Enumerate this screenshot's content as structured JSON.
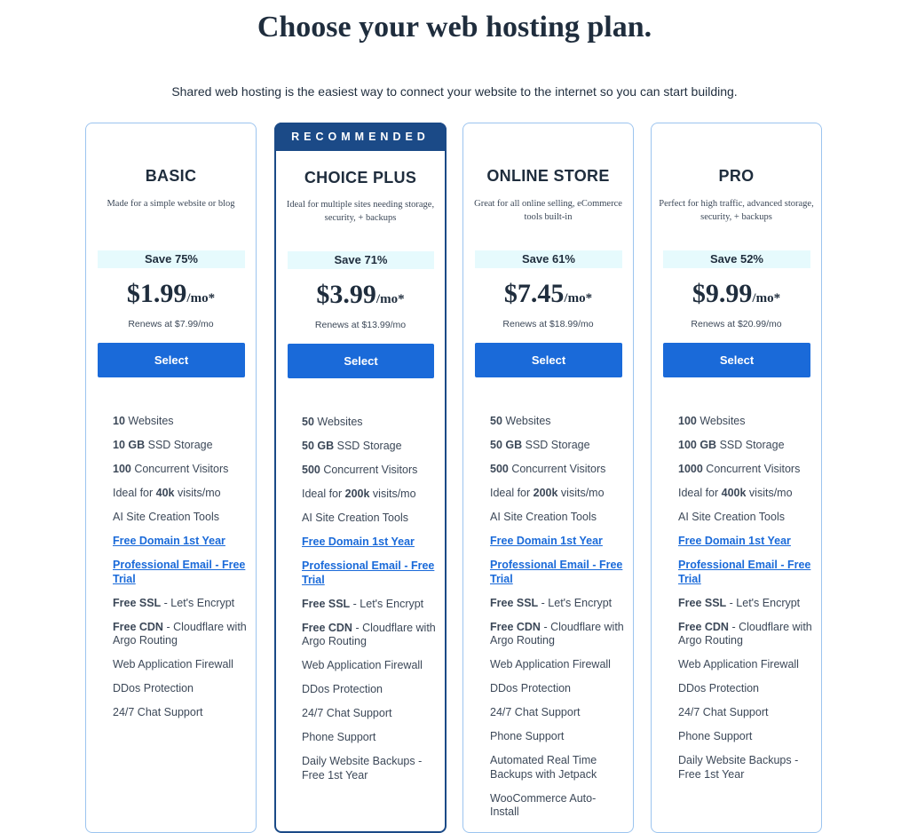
{
  "header": {
    "title": "Choose your web hosting plan.",
    "subtitle": "Shared web hosting is the easiest way to connect your website to the internet so you can start building."
  },
  "recommended_label": "RECOMMENDED",
  "colors": {
    "accent": "#1a6ad9",
    "recommended": "#1b4a87",
    "save_bg": "#e6fafd",
    "card_border": "#9cc4ef"
  },
  "plans": [
    {
      "name": "BASIC",
      "description": "Made for a simple website or blog",
      "save": "Save 75%",
      "price": "$1.99",
      "per": "/mo*",
      "renews": "Renews at $7.99/mo",
      "button": "Select",
      "features": [
        {
          "bold": "10",
          "text": " Websites"
        },
        {
          "bold": "10 GB",
          "text": " SSD Storage"
        },
        {
          "bold": "100",
          "text": " Concurrent Visitors"
        },
        {
          "pre": "Ideal for ",
          "bold": "40k",
          "text": " visits/mo"
        },
        {
          "text": "AI Site Creation Tools"
        },
        {
          "link": "Free Domain 1st Year"
        },
        {
          "link": "Professional Email - Free Trial"
        },
        {
          "bold": "Free SSL",
          "text": " - Let's Encrypt"
        },
        {
          "bold": "Free CDN",
          "text": " - Cloudflare with Argo Routing"
        },
        {
          "text": "Web Application Firewall"
        },
        {
          "text": "DDos Protection"
        },
        {
          "text": "24/7 Chat Support"
        }
      ]
    },
    {
      "name": "CHOICE PLUS",
      "recommended": true,
      "description": "Ideal for multiple sites needing storage, security, + backups",
      "save": "Save 71%",
      "price": "$3.99",
      "per": "/mo*",
      "renews": "Renews at $13.99/mo",
      "button": "Select",
      "features": [
        {
          "bold": "50",
          "text": " Websites"
        },
        {
          "bold": "50 GB",
          "text": " SSD Storage"
        },
        {
          "bold": "500",
          "text": " Concurrent Visitors"
        },
        {
          "pre": "Ideal for ",
          "bold": "200k",
          "text": " visits/mo"
        },
        {
          "text": "AI Site Creation Tools"
        },
        {
          "link": "Free Domain 1st Year"
        },
        {
          "link": "Professional Email - Free Trial"
        },
        {
          "bold": "Free SSL",
          "text": " - Let's Encrypt"
        },
        {
          "bold": "Free CDN",
          "text": " - Cloudflare with Argo Routing"
        },
        {
          "text": "Web Application Firewall"
        },
        {
          "text": "DDos Protection"
        },
        {
          "text": "24/7 Chat Support"
        },
        {
          "text": "Phone Support"
        },
        {
          "text": "Daily Website Backups - Free 1st Year"
        }
      ]
    },
    {
      "name": "ONLINE STORE",
      "description": "Great for all online selling, eCommerce tools built-in",
      "save": "Save 61%",
      "price": "$7.45",
      "per": "/mo*",
      "renews": "Renews at $18.99/mo",
      "button": "Select",
      "features": [
        {
          "bold": "50",
          "text": " Websites"
        },
        {
          "bold": "50 GB",
          "text": " SSD Storage"
        },
        {
          "bold": "500",
          "text": " Concurrent Visitors"
        },
        {
          "pre": "Ideal for ",
          "bold": "200k",
          "text": " visits/mo"
        },
        {
          "text": "AI Site Creation Tools"
        },
        {
          "link": "Free Domain 1st Year"
        },
        {
          "link": "Professional Email - Free Trial"
        },
        {
          "bold": "Free SSL",
          "text": " - Let's Encrypt"
        },
        {
          "bold": "Free CDN",
          "text": " - Cloudflare with Argo Routing"
        },
        {
          "text": "Web Application Firewall"
        },
        {
          "text": "DDos Protection"
        },
        {
          "text": "24/7 Chat Support"
        },
        {
          "text": "Phone Support"
        },
        {
          "text": "Automated Real Time Backups with Jetpack"
        },
        {
          "text": "WooCommerce Auto-Install"
        }
      ]
    },
    {
      "name": "PRO",
      "description": "Perfect for high traffic, advanced storage, security, + backups",
      "save": "Save 52%",
      "price": "$9.99",
      "per": "/mo*",
      "renews": "Renews at $20.99/mo",
      "button": "Select",
      "features": [
        {
          "bold": "100",
          "text": " Websites"
        },
        {
          "bold": "100 GB",
          "text": " SSD Storage"
        },
        {
          "bold": "1000",
          "text": " Concurrent Visitors"
        },
        {
          "pre": "Ideal for ",
          "bold": "400k",
          "text": " visits/mo"
        },
        {
          "text": "AI Site Creation Tools"
        },
        {
          "link": "Free Domain 1st Year"
        },
        {
          "link": "Professional Email - Free Trial"
        },
        {
          "bold": "Free SSL",
          "text": " - Let's Encrypt"
        },
        {
          "bold": "Free CDN",
          "text": " - Cloudflare with Argo Routing"
        },
        {
          "text": "Web Application Firewall"
        },
        {
          "text": "DDos Protection"
        },
        {
          "text": "24/7 Chat Support"
        },
        {
          "text": "Phone Support"
        },
        {
          "text": "Daily Website Backups - Free 1st Year"
        }
      ]
    }
  ]
}
